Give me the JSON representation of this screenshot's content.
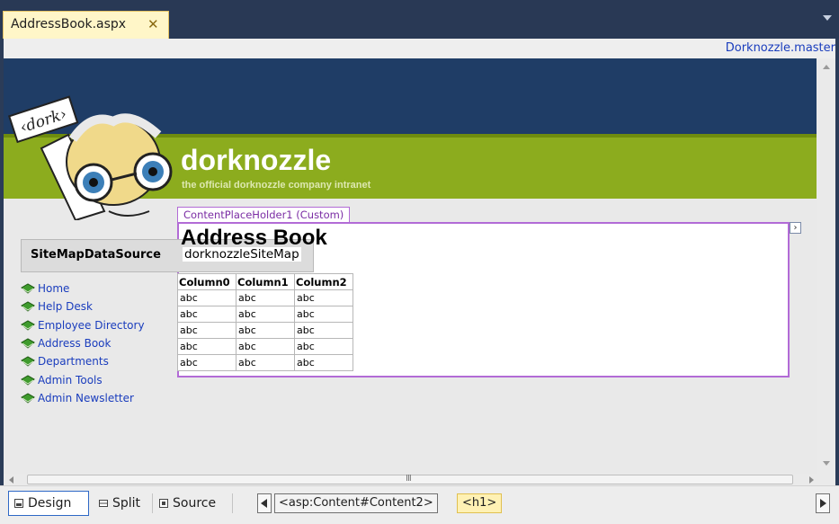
{
  "editor": {
    "tab_label": "AddressBook.aspx",
    "tab_close": "✕",
    "master_page": "Dorknozzle.master"
  },
  "site": {
    "name": "dorknozzle",
    "tagline": "the official dorknozzle company intranet",
    "logo_text": "‹dork›"
  },
  "placeholder": {
    "label": "ContentPlaceHolder1 (Custom)",
    "smart_tag": "›"
  },
  "page": {
    "heading": "Address Book"
  },
  "datasource": {
    "type": "SiteMapDataSource",
    "separator": "-",
    "id": "dorknozzleSiteMap"
  },
  "nav": {
    "items": [
      {
        "label": "Home"
      },
      {
        "label": "Help Desk"
      },
      {
        "label": "Employee Directory"
      },
      {
        "label": "Address Book"
      },
      {
        "label": "Departments"
      },
      {
        "label": "Admin Tools"
      },
      {
        "label": "Admin Newsletter"
      }
    ]
  },
  "grid": {
    "columns": [
      "Column0",
      "Column1",
      "Column2"
    ],
    "rows": [
      [
        "abc",
        "abc",
        "abc"
      ],
      [
        "abc",
        "abc",
        "abc"
      ],
      [
        "abc",
        "abc",
        "abc"
      ],
      [
        "abc",
        "abc",
        "abc"
      ],
      [
        "abc",
        "abc",
        "abc"
      ]
    ]
  },
  "scrollbar": {
    "grip": "III"
  },
  "view_buttons": {
    "design": "Design",
    "split": "Split",
    "source": "Source"
  },
  "breadcrumbs": {
    "content": "<asp:Content#Content2>",
    "h1": "<h1>"
  },
  "colors": {
    "header_blue": "#1f3d66",
    "header_green": "#8cac1e",
    "placeholder_border": "#b26bd6",
    "link": "#1a3dbd"
  }
}
